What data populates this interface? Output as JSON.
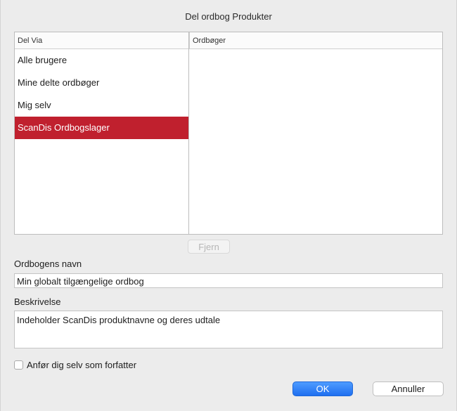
{
  "dialog": {
    "title": "Del ordbog Produkter"
  },
  "share_via": {
    "header": "Del Via",
    "items": [
      {
        "label": "Alle brugere",
        "selected": false
      },
      {
        "label": "Mine delte ordbøger",
        "selected": false
      },
      {
        "label": "Mig selv",
        "selected": false
      },
      {
        "label": "ScanDis Ordbogslager",
        "selected": true
      }
    ]
  },
  "dictionaries": {
    "header": "Ordbøger",
    "items": []
  },
  "remove_button": {
    "label": "Fjern",
    "enabled": false
  },
  "name": {
    "label": "Ordbogens navn",
    "value": "Min globalt tilgængelige ordbog"
  },
  "description": {
    "label": "Beskrivelse",
    "value": "Indeholder ScanDis produktnavne og deres udtale"
  },
  "author_checkbox": {
    "label": "Anfør dig selv som forfatter",
    "checked": false
  },
  "buttons": {
    "ok": "OK",
    "cancel": "Annuller"
  },
  "colors": {
    "selection": "#c0202e",
    "primary_button": "#1f6ff0"
  }
}
